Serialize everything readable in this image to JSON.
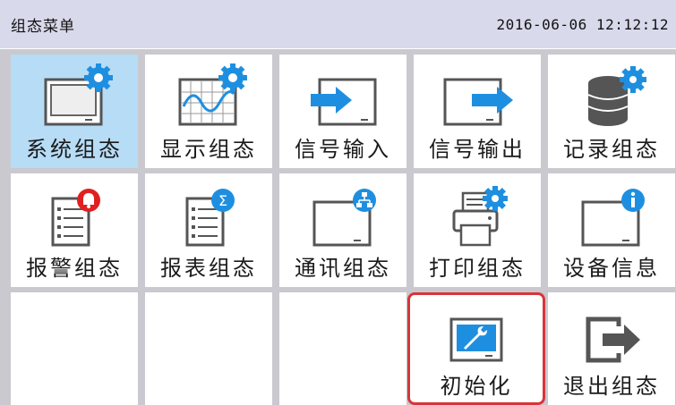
{
  "header": {
    "title": "组态菜单",
    "datetime": "2016-06-06 12:12:12"
  },
  "tiles": [
    {
      "label": "系统组态",
      "icon": "monitor-gear-icon",
      "selected": true
    },
    {
      "label": "显示组态",
      "icon": "chart-gear-icon"
    },
    {
      "label": "信号输入",
      "icon": "signal-input-icon"
    },
    {
      "label": "信号输出",
      "icon": "signal-output-icon"
    },
    {
      "label": "记录组态",
      "icon": "database-gear-icon"
    },
    {
      "label": "报警组态",
      "icon": "alarm-list-icon"
    },
    {
      "label": "报表组态",
      "icon": "report-sum-icon"
    },
    {
      "label": "通讯组态",
      "icon": "network-icon"
    },
    {
      "label": "打印组态",
      "icon": "printer-gear-icon"
    },
    {
      "label": "设备信息",
      "icon": "device-info-icon"
    },
    {
      "label": "",
      "icon": ""
    },
    {
      "label": "",
      "icon": ""
    },
    {
      "label": "",
      "icon": ""
    },
    {
      "label": "初始化",
      "icon": "initialize-wrench-icon",
      "highlighted": true
    },
    {
      "label": "退出组态",
      "icon": "exit-icon"
    }
  ],
  "colors": {
    "header_bg": "#d9d9ec",
    "selected_bg": "#b7dcf6",
    "accent_blue": "#1e8fe0",
    "alert_red": "#e02020",
    "highlight_border": "#d9343a"
  }
}
